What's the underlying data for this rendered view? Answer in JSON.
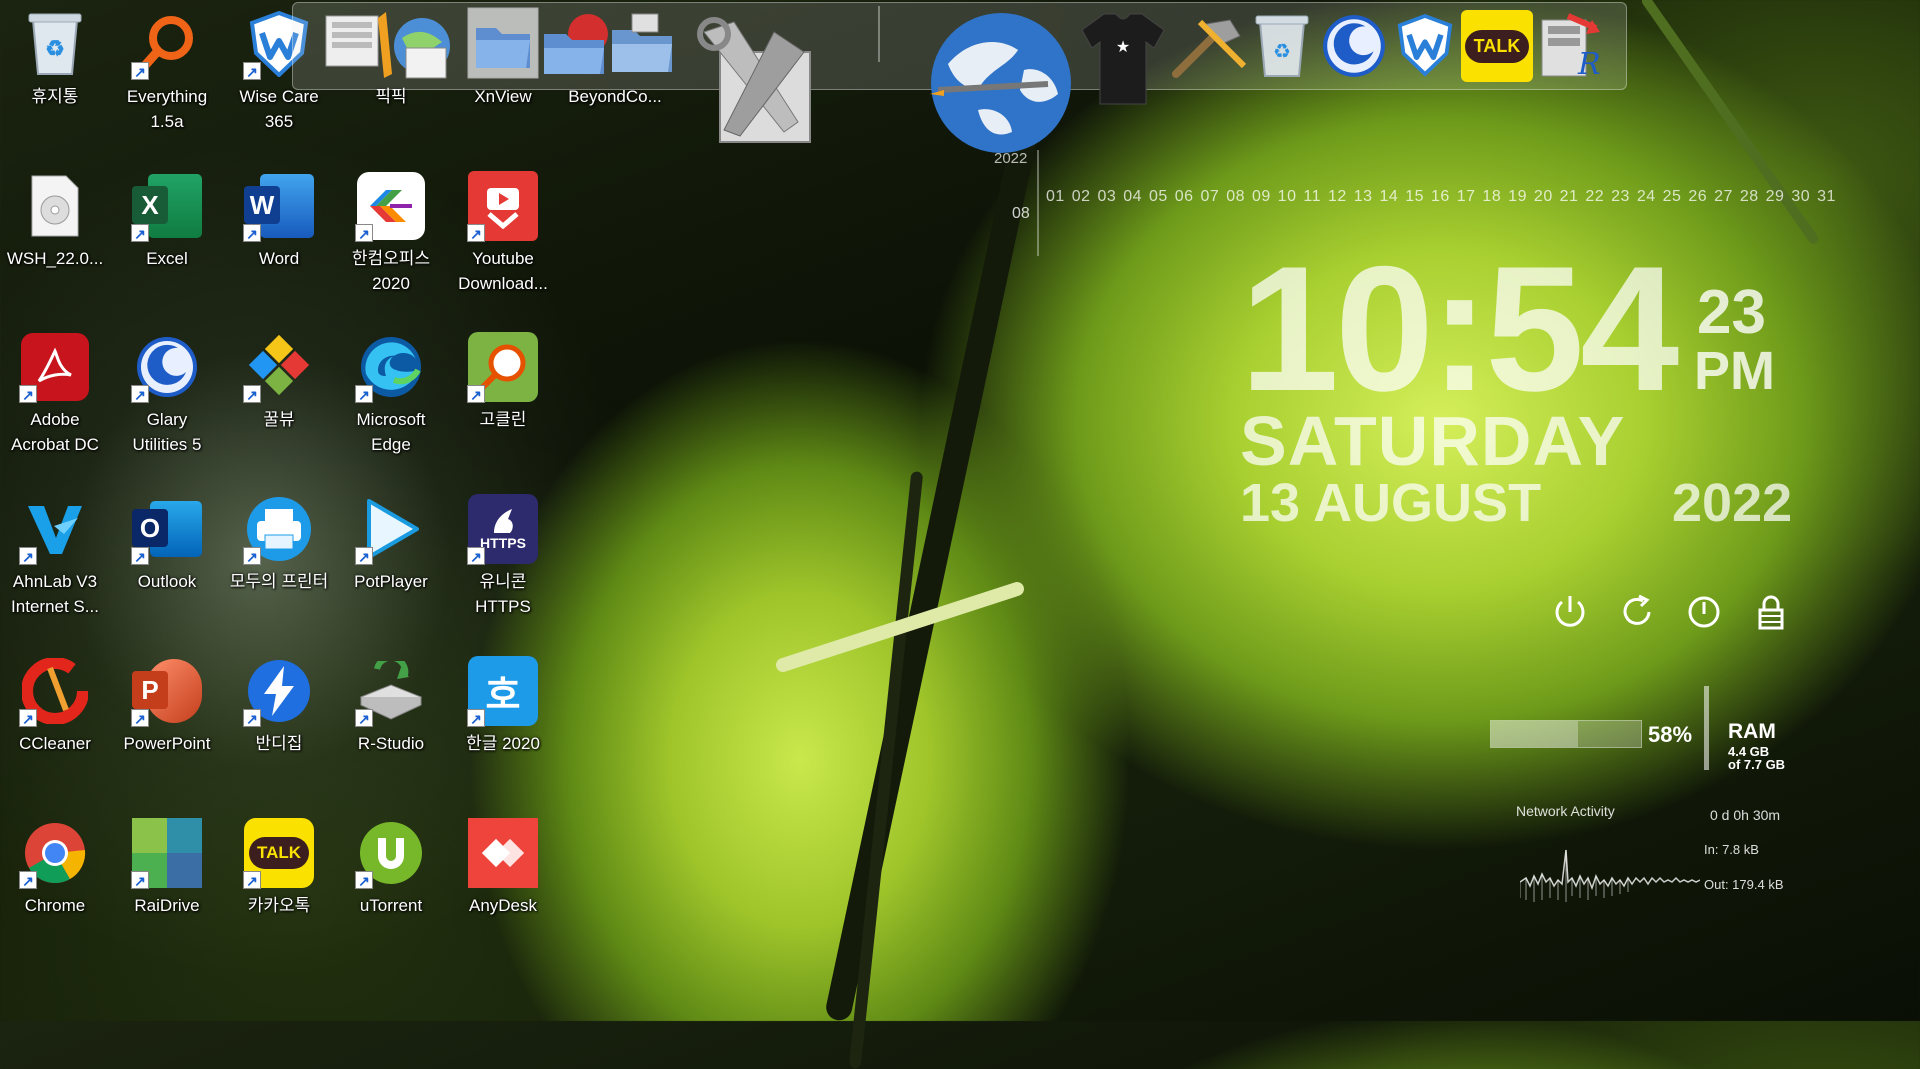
{
  "desktop": {
    "icons": [
      {
        "label": "휴지통",
        "icon": "recycle-bin-icon"
      },
      {
        "label": "Everything 1.5a",
        "icon": "everything-search-icon"
      },
      {
        "label": "Wise Care 365",
        "icon": "wise-care-icon"
      },
      {
        "label": "픽픽",
        "icon": "picpick-icon"
      },
      {
        "label": "XnView",
        "icon": "xnview-icon"
      },
      {
        "label": "BeyondCo...",
        "icon": "beyond-compare-icon"
      },
      {
        "label": "WSH_22.0...",
        "icon": "disc-image-icon"
      },
      {
        "label": "Excel",
        "icon": "excel-icon"
      },
      {
        "label": "Word",
        "icon": "word-icon"
      },
      {
        "label": "한컴오피스 2020",
        "icon": "hancom-office-icon"
      },
      {
        "label": "Youtube Download...",
        "icon": "youtube-downloader-icon"
      },
      {
        "label": "Adobe Acrobat DC",
        "icon": "acrobat-icon"
      },
      {
        "label": "Glary Utilities 5",
        "icon": "glary-utilities-icon"
      },
      {
        "label": "꿀뷰",
        "icon": "honeyview-icon"
      },
      {
        "label": "Microsoft Edge",
        "icon": "edge-icon"
      },
      {
        "label": "고클린",
        "icon": "goclean-icon"
      },
      {
        "label": "AhnLab V3 Internet S...",
        "icon": "v3-icon"
      },
      {
        "label": "Outlook",
        "icon": "outlook-icon"
      },
      {
        "label": "모두의 프린터",
        "icon": "printer-icon"
      },
      {
        "label": "PotPlayer",
        "icon": "potplayer-icon"
      },
      {
        "label": "유니콘 HTTPS",
        "icon": "unicorn-https-icon"
      },
      {
        "label": "CCleaner",
        "icon": "ccleaner-icon"
      },
      {
        "label": "PowerPoint",
        "icon": "powerpoint-icon"
      },
      {
        "label": "반디집",
        "icon": "bandizip-icon"
      },
      {
        "label": "R-Studio",
        "icon": "r-studio-icon"
      },
      {
        "label": "한글 2020",
        "icon": "hangul-icon"
      },
      {
        "label": "Chrome",
        "icon": "chrome-icon"
      },
      {
        "label": "RaiDrive",
        "icon": "raidrive-icon"
      },
      {
        "label": "카카오톡",
        "icon": "kakaotalk-icon"
      },
      {
        "label": "uTorrent",
        "icon": "utorrent-icon"
      },
      {
        "label": "AnyDesk",
        "icon": "anydesk-icon"
      }
    ],
    "icon_glyphs": {
      "excel": "X",
      "word": "W",
      "outlook": "O",
      "powerpoint": "P",
      "hangul": "호",
      "kakao": "TALK",
      "unicorn": "HTTPS"
    }
  },
  "dock": {
    "items": [
      "screenshot-tool-icon",
      "folder-icon",
      "folder-icon",
      "network-folder-icon",
      "system-tools-icon",
      "globe-icon",
      "tshirt-icon",
      "hammer-icon",
      "recycle-bin-icon",
      "glary-utilities-icon",
      "wise-care-icon",
      "kakaotalk-icon",
      "r-studio-icon"
    ],
    "kakao_label": "TALK"
  },
  "calendar": {
    "year": "2022",
    "month": "08",
    "days": "01 02 03 04 05 06 07 08 09 10 11 12 13 14 15 16 17 18 19 20 21 22 23 24 25 26 27 28 29 30 31"
  },
  "clock": {
    "time": "10:54",
    "seconds": "23",
    "ampm": "PM",
    "day": "SATURDAY",
    "date": "13 AUGUST",
    "year": "2022"
  },
  "power": {
    "buttons": [
      "power-icon",
      "restart-icon",
      "logoff-icon",
      "lock-icon"
    ]
  },
  "ram": {
    "percent": "58%",
    "percent_value": 58,
    "title": "RAM",
    "used": "4.4 GB",
    "total": "of 7.7 GB"
  },
  "network": {
    "title": "Network Activity",
    "uptime": "0 d 0h 30m",
    "in": "In: 7.8 kB",
    "out": "Out: 179.4 kB"
  }
}
